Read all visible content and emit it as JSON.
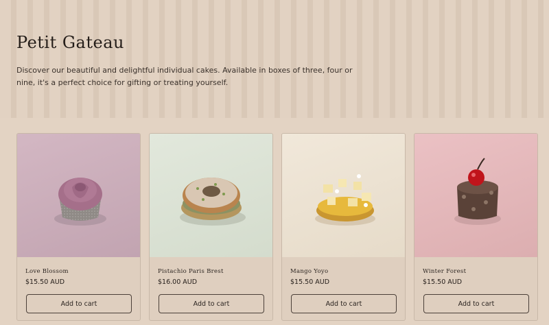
{
  "collection": {
    "title": "Petit Gateau",
    "description": "Discover our beautiful and delightful individual cakes. Available in boxes of three, four or nine, it's a perfect choice for gifting or treating yourself."
  },
  "products": [
    {
      "name": "Love Blossom",
      "price": "$15.50 AUD",
      "button": "Add to cart",
      "image_bg": "#cdb0bc",
      "image_subject": "rose-cake"
    },
    {
      "name": "Pistachio Paris Brest",
      "price": "$16.00 AUD",
      "button": "Add to cart",
      "image_bg": "#dbe3d6",
      "image_subject": "paris-brest"
    },
    {
      "name": "Mango Yoyo",
      "price": "$15.50 AUD",
      "button": "Add to cart",
      "image_bg": "#ede3d3",
      "image_subject": "mango-tart"
    },
    {
      "name": "Winter Forest",
      "price": "$15.50 AUD",
      "button": "Add to cart",
      "image_bg": "#e6b9bc",
      "image_subject": "chocolate-cherry-cake"
    }
  ]
}
